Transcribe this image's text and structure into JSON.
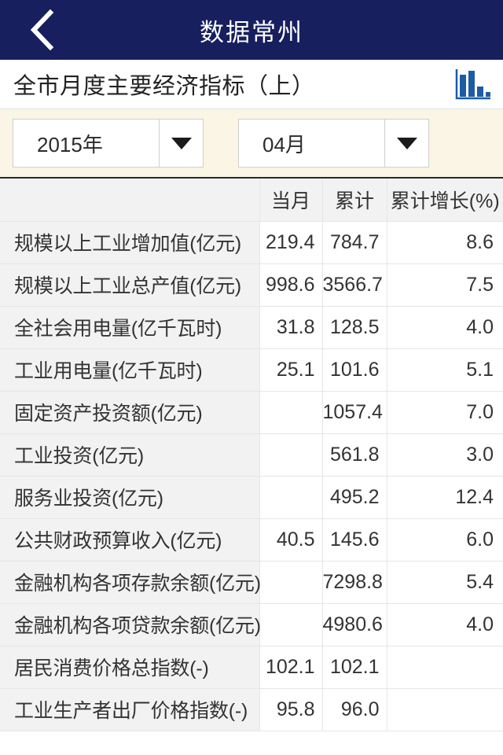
{
  "navbar": {
    "back_icon": "chevron-left-icon",
    "title": "数据常州"
  },
  "page": {
    "title": "全市月度主要经济指标（上）",
    "chart_icon": "bar-chart-icon",
    "accent_navy": "#171f5e",
    "accent_blue": "#1d5ba5",
    "toolbar_bg": "#faf5e4"
  },
  "filters": {
    "year": {
      "value": "2015年",
      "arrow_icon": "caret-down-icon"
    },
    "month": {
      "value": "04月",
      "arrow_icon": "caret-down-icon"
    }
  },
  "table": {
    "columns": [
      "",
      "当月",
      "累计",
      "累计增长(%)"
    ],
    "rows": [
      {
        "label": "规模以上工业增加值(亿元)",
        "month": "219.4",
        "cumulative": "784.7",
        "growth": "8.6"
      },
      {
        "label": "规模以上工业总产值(亿元)",
        "month": "998.6",
        "cumulative": "3566.7",
        "growth": "7.5"
      },
      {
        "label": "全社会用电量(亿千瓦时)",
        "month": "31.8",
        "cumulative": "128.5",
        "growth": "4.0"
      },
      {
        "label": "工业用电量(亿千瓦时)",
        "month": "25.1",
        "cumulative": "101.6",
        "growth": "5.1"
      },
      {
        "label": "固定资产投资额(亿元)",
        "month": "",
        "cumulative": "1057.4",
        "growth": "7.0"
      },
      {
        "label": "工业投资(亿元)",
        "month": "",
        "cumulative": "561.8",
        "growth": "3.0"
      },
      {
        "label": "服务业投资(亿元)",
        "month": "",
        "cumulative": "495.2",
        "growth": "12.4"
      },
      {
        "label": "公共财政预算收入(亿元)",
        "month": "40.5",
        "cumulative": "145.6",
        "growth": "6.0"
      },
      {
        "label": "金融机构各项存款余额(亿元)",
        "month": "",
        "cumulative": "7298.8",
        "growth": "5.4"
      },
      {
        "label": "金融机构各项贷款余额(亿元)",
        "month": "",
        "cumulative": "4980.6",
        "growth": "4.0"
      },
      {
        "label": "居民消费价格总指数(-)",
        "month": "102.1",
        "cumulative": "102.1",
        "growth": ""
      },
      {
        "label": "工业生产者出厂价格指数(-)",
        "month": "95.8",
        "cumulative": "96.0",
        "growth": ""
      }
    ]
  }
}
